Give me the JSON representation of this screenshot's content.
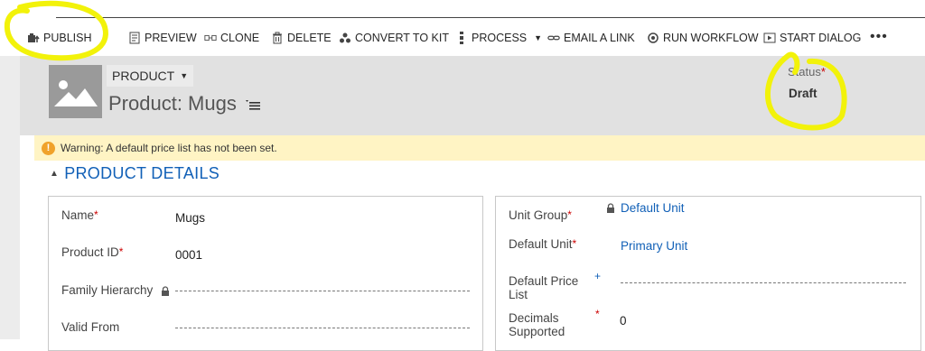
{
  "toolbar": {
    "publish": "PUBLISH",
    "preview": "PREVIEW",
    "clone": "CLONE",
    "delete": "DELETE",
    "convert_to_kit": "CONVERT TO KIT",
    "process": "PROCESS",
    "email_link": "EMAIL A LINK",
    "run_workflow": "RUN WORKFLOW",
    "start_dialog": "START DIALOG",
    "more": "•••"
  },
  "header": {
    "entity_label": "PRODUCT",
    "title": "Product: Mugs",
    "status_label": "Status",
    "status_required": "*",
    "status_value": "Draft"
  },
  "warning": {
    "text": "Warning: A default price list has not been set."
  },
  "section": {
    "title": "PRODUCT DETAILS"
  },
  "left_fields": [
    {
      "label": "Name",
      "required": "*",
      "value": "Mugs"
    },
    {
      "label": "Product ID",
      "required": "*",
      "value": "0001"
    },
    {
      "label": "Family Hierarchy",
      "required": "",
      "value": ""
    },
    {
      "label": "Valid From",
      "required": "",
      "value": ""
    }
  ],
  "right_fields": [
    {
      "label": "Unit Group",
      "required": "*",
      "value": "Default Unit"
    },
    {
      "label": "Default Unit",
      "required": "*",
      "value": "Primary Unit"
    },
    {
      "label": "Default Price List",
      "required": "+",
      "value": ""
    },
    {
      "label": "Decimals Supported",
      "required": "*",
      "value": "0"
    }
  ],
  "colors": {
    "accent_blue": "#1160b7",
    "highlight_yellow": "#f2f20a",
    "warning_bg": "#fff4c4",
    "header_bg": "#e1e1e1"
  }
}
